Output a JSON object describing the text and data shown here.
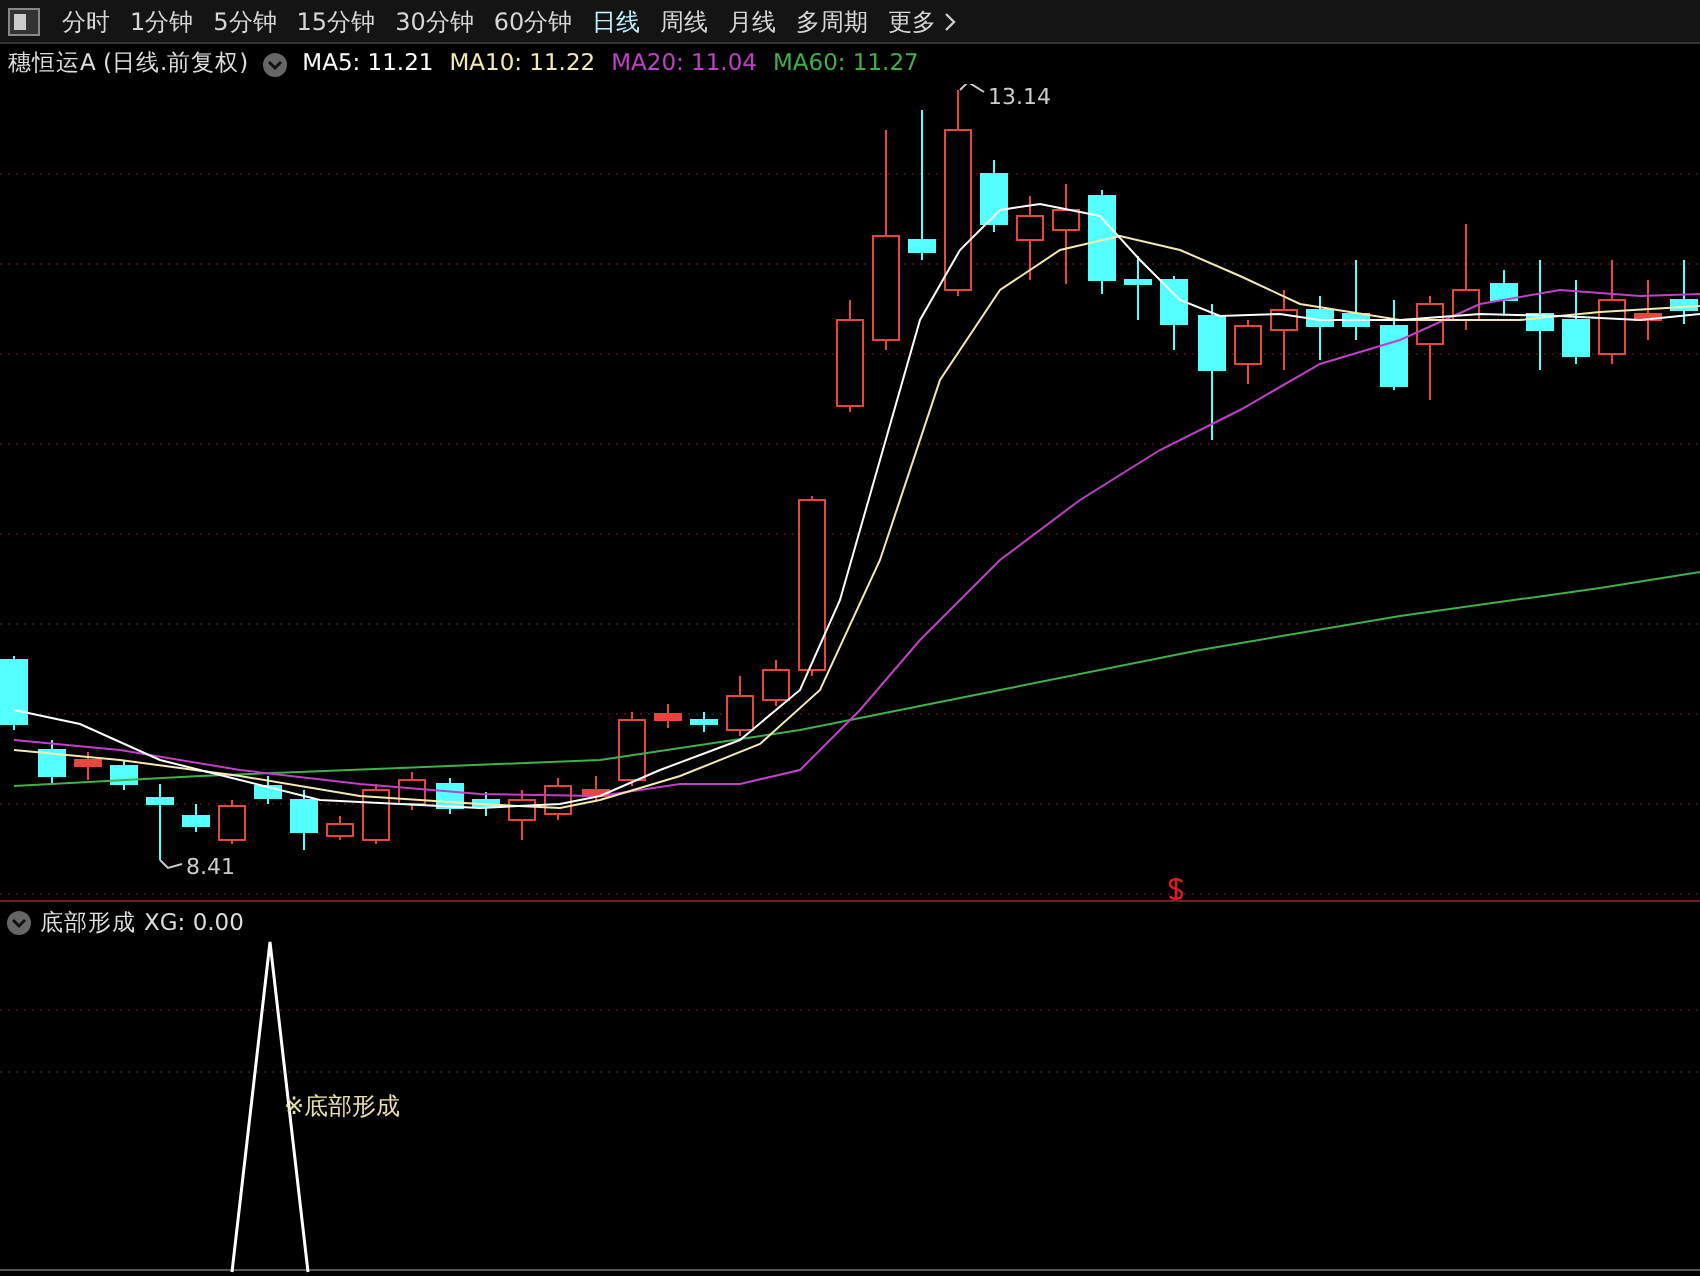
{
  "toolbar": {
    "tabs": [
      {
        "label": "分时",
        "selected": false
      },
      {
        "label": "1分钟",
        "selected": false
      },
      {
        "label": "5分钟",
        "selected": false
      },
      {
        "label": "15分钟",
        "selected": false
      },
      {
        "label": "30分钟",
        "selected": false
      },
      {
        "label": "60分钟",
        "selected": false
      },
      {
        "label": "日线",
        "selected": true
      },
      {
        "label": "周线",
        "selected": false
      },
      {
        "label": "月线",
        "selected": false
      },
      {
        "label": "多周期",
        "selected": false
      },
      {
        "label": "更多",
        "selected": false
      }
    ]
  },
  "legend": {
    "title": "穗恒运A (日线.前复权)",
    "items": [
      {
        "label": "MA5: 11.21",
        "color": "#ffffff"
      },
      {
        "label": "MA10: 11.22",
        "color": "#f2eab0"
      },
      {
        "label": "MA20: 11.04",
        "color": "#c040c8"
      },
      {
        "label": "MA60: 11.27",
        "color": "#3fb04a"
      }
    ]
  },
  "price_chart": {
    "high_label": "13.14",
    "low_label": "8.41"
  },
  "indicator": {
    "title": "底部形成",
    "reading": "XG: 0.00",
    "signal_label": "※底部形成"
  }
}
